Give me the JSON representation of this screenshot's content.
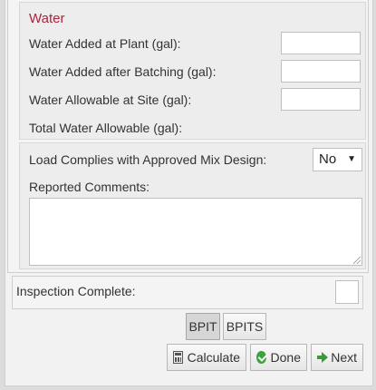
{
  "water": {
    "title": "Water",
    "added_at_plant_label": "Water Added at Plant (gal):",
    "added_after_batching_label": "Water Added after Batching (gal):",
    "allowable_at_site_label": "Water Allowable at Site (gal):",
    "total_allowable_label": "Total Water Allowable (gal):",
    "added_at_plant_value": "",
    "added_after_batching_value": "",
    "allowable_at_site_value": ""
  },
  "load": {
    "complies_label": "Load Complies with Approved Mix Design:",
    "complies_value": "No",
    "comments_label": "Reported Comments:",
    "comments_value": ""
  },
  "inspection": {
    "label": "Inspection Complete:"
  },
  "buttons": {
    "bpit": "BPIT",
    "bpits": "BPITS",
    "calculate": "Calculate",
    "done": "Done",
    "next": "Next"
  },
  "icons": {
    "calculate": "calculator-icon",
    "done": "check-circle-icon",
    "next": "arrow-right-icon",
    "select": "chevron-down-icon",
    "textarea": "resize-grip-icon"
  },
  "colors": {
    "section_title": "#b0233a",
    "done_icon": "#3da33d",
    "next_icon": "#3a9a3a"
  }
}
